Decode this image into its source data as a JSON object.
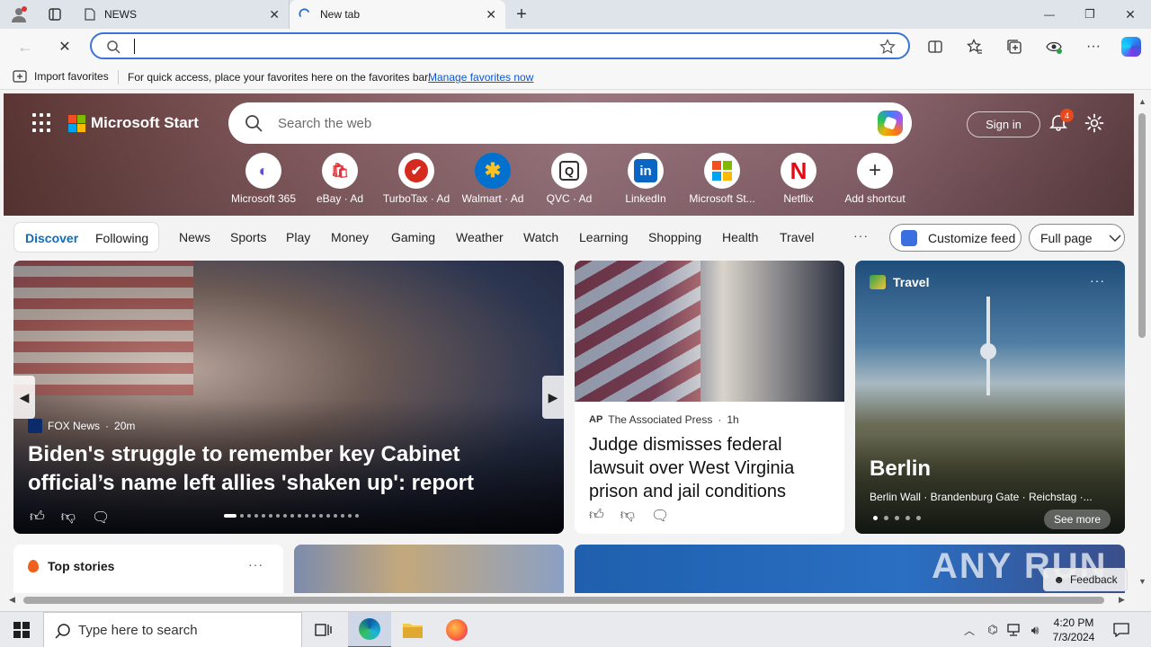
{
  "browser": {
    "tabs": [
      {
        "label": "NEWS",
        "close": "✕"
      },
      {
        "label": "New tab",
        "close": "✕"
      }
    ],
    "new_tab_button": "+",
    "window_controls": {
      "minimize": "—",
      "restore": "❐",
      "close": "✕"
    },
    "address_value": "",
    "favbar": {
      "import_label": "Import favorites",
      "message": "For quick access, place your favorites here on the favorites bar.",
      "manage_link": "Manage favorites now"
    }
  },
  "header": {
    "brand": "Microsoft Start",
    "search_placeholder": "Search the web",
    "signin": "Sign in",
    "notification_count": "4"
  },
  "shortcuts": [
    {
      "label": "Microsoft 365",
      "icon": "microsoft-365-icon",
      "glyph": "◐",
      "color": "#5b4fd8"
    },
    {
      "label": "eBay · Ad",
      "icon": "ebay-icon",
      "glyph": "🛍",
      "color": "#e53238"
    },
    {
      "label": "TurboTax · Ad",
      "icon": "turbotax-icon",
      "glyph": "✔",
      "color": "#d52b1e"
    },
    {
      "label": "Walmart · Ad",
      "icon": "walmart-icon",
      "glyph": "✱",
      "color": "#0071ce"
    },
    {
      "label": "QVC · Ad",
      "icon": "qvc-icon",
      "glyph": "Q",
      "color": "#333333"
    },
    {
      "label": "LinkedIn",
      "icon": "linkedin-icon",
      "glyph": "in",
      "color": "#0a66c2"
    },
    {
      "label": "Microsoft St...",
      "icon": "microsoft-store-icon",
      "glyph": "▦",
      "color": "#f25022"
    },
    {
      "label": "Netflix",
      "icon": "netflix-icon",
      "glyph": "N",
      "color": "#e50914"
    },
    {
      "label": "Add shortcut",
      "icon": "add-icon",
      "glyph": "+",
      "color": "#333333"
    }
  ],
  "feed_nav": {
    "discover": "Discover",
    "following": "Following",
    "tabs": [
      "News",
      "Sports",
      "Play",
      "Money",
      "Gaming",
      "Weather",
      "Watch",
      "Learning",
      "Shopping",
      "Health",
      "Travel"
    ],
    "more": "···",
    "customize": "Customize feed",
    "layout": "Full page"
  },
  "cards": {
    "main": {
      "source": "FOX News",
      "time": "20m",
      "title": "Biden's struggle to remember key Cabinet official’s name left allies 'shaken up': report"
    },
    "ap": {
      "source": "The Associated Press",
      "time": "1h",
      "title": "Judge dismisses federal lawsuit over West Virginia prison and jail conditions"
    },
    "travel": {
      "category": "Travel",
      "more": "···",
      "title": "Berlin",
      "subtitle": "Berlin Wall · Brandenburg Gate · Reichstag ·...",
      "see_more": "See more"
    },
    "top_stories": {
      "title": "Top stories",
      "more": "···"
    }
  },
  "feedback": "Feedback",
  "watermark": "ANY RUN",
  "taskbar": {
    "search_placeholder": "Type here to search",
    "time": "4:20 PM",
    "date": "7/3/2024"
  }
}
